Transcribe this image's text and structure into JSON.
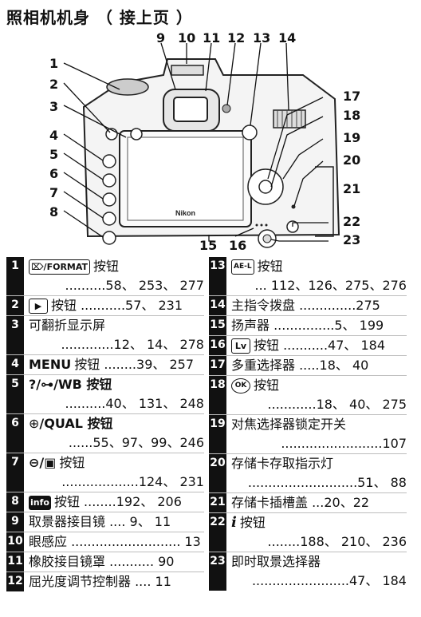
{
  "title": "照相机机身 （ 接上页 ）",
  "diagram": {
    "callouts": [
      "1",
      "2",
      "3",
      "4",
      "5",
      "6",
      "7",
      "8",
      "9",
      "10",
      "11",
      "12",
      "13",
      "14",
      "15",
      "16",
      "17",
      "18",
      "19",
      "20",
      "21",
      "22",
      "23"
    ],
    "brand": "Nikon"
  },
  "index": {
    "left": [
      {
        "num": "1",
        "icon": "trash-format-icon",
        "icon_text": "⌦/FORMAT",
        "label": "按钮",
        "pages": "..........58、 253、 277"
      },
      {
        "num": "2",
        "icon": "play-icon",
        "icon_text": "▶",
        "label": "按钮 ...........57、 231"
      },
      {
        "num": "3",
        "label": "可翻折显示屏",
        "pages": ".............12、 14、 278"
      },
      {
        "num": "4",
        "icon_text": "MENU",
        "label": "按钮 ........39、 257"
      },
      {
        "num": "5",
        "icon_text": "?/⊶",
        "label": "/WB 按钮",
        "pages": "..........40、 131、 248"
      },
      {
        "num": "6",
        "icon_text": "⊕",
        "label": "/QUAL 按钮",
        "pages": "......55、97、99、246"
      },
      {
        "num": "7",
        "icon_text": "⊖/▣",
        "label": "按钮",
        "pages": "...................124、 231"
      },
      {
        "num": "8",
        "icon_text": "info",
        "label": "按钮 ........192、 206"
      },
      {
        "num": "9",
        "label": "取景器接目镜 .... 9、 11"
      },
      {
        "num": "10",
        "label": "眼感应 ........................... 13"
      },
      {
        "num": "11",
        "label": "橡胶接目镜罩 ........... 90"
      },
      {
        "num": "12",
        "label": "屈光度调节控制器 .... 11"
      }
    ],
    "right": [
      {
        "num": "13",
        "icon_text": "AE-L",
        "label": "按钮",
        "pages": "... 112、126、275、276"
      },
      {
        "num": "14",
        "label": "主指令拨盘 ..............275"
      },
      {
        "num": "15",
        "label": "扬声器 ...............5、 199"
      },
      {
        "num": "16",
        "icon_text": "Lv",
        "label": "按钮 ...........47、 184"
      },
      {
        "num": "17",
        "label": "多重选择器 .....18、 40"
      },
      {
        "num": "18",
        "icon_text": "OK",
        "label": "按钮",
        "pages": "............18、 40、 275"
      },
      {
        "num": "19",
        "label": "对焦选择器锁定开关",
        "pages": ".........................107"
      },
      {
        "num": "20",
        "label": "存储卡存取指示灯",
        "pages": "...........................51、 88"
      },
      {
        "num": "21",
        "label": "存储卡插槽盖 ...20、22"
      },
      {
        "num": "22",
        "icon_text": "i",
        "label": "按钮",
        "pages": "........188、 210、 236"
      },
      {
        "num": "23",
        "label": "即时取景选择器",
        "pages": "........................47、 184"
      }
    ]
  }
}
